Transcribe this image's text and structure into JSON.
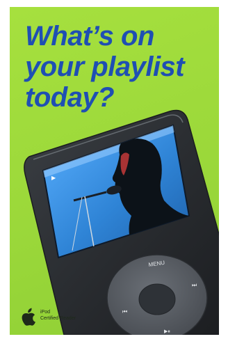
{
  "headline": {
    "line1": "What’s on",
    "line2": "your playlist",
    "line3": "today?"
  },
  "device": {
    "menu_label": "MENU",
    "prev_label": "⏮",
    "next_label": "⏭",
    "play_label": "▶⏸",
    "play_indicator": "▶"
  },
  "badge": {
    "logo_icon": "apple-logo",
    "line1": "iPod",
    "line2": "Certified Reader"
  },
  "colors": {
    "background": "#9bd83a",
    "headline": "#1f4fb3",
    "device_body": "#2c2f33",
    "screen_bg": "#3a8fe0"
  }
}
